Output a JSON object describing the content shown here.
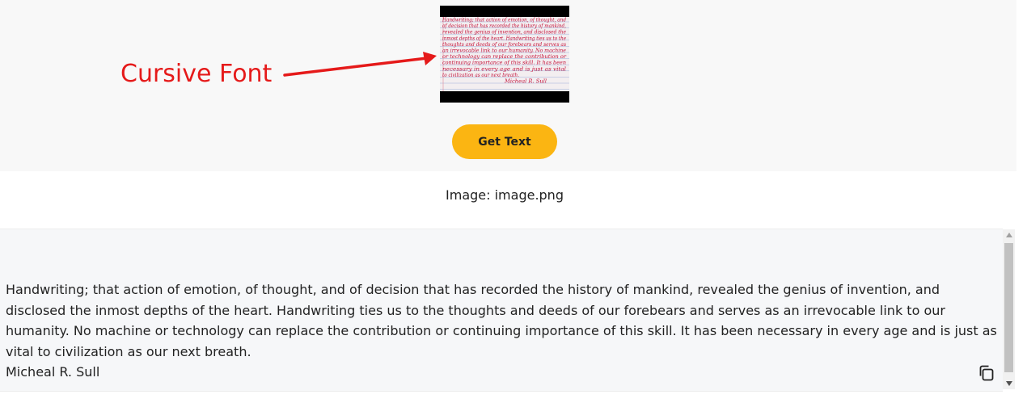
{
  "annotation": {
    "label": "Cursive Font",
    "color": "#e51a1a"
  },
  "preview": {
    "alt": "handwritten cursive sample image",
    "handwriting_lines": [
      "Handwriting; that action of emotion, of thought, and",
      "of decision that has recorded the history of mankind,",
      "revealed the genius of invention, and disclosed the",
      "inmost depths of the heart. Handwriting ties us to the",
      "thoughts and deeds of our forebears and serves as",
      "an irrevocable link to our humanity. No machine",
      "or technology can replace the contribution or",
      "continuing importance of this skill. It has been",
      "necessary in every age and is just as vital",
      "to civilization as our next breath.",
      "Micheal R. Sull"
    ]
  },
  "button": {
    "get_text_label": "Get Text",
    "color": "#fbb512"
  },
  "caption": {
    "image_name": "Image: image.png"
  },
  "result": {
    "paragraph": "Handwriting; that action of emotion, of thought, and of decision that has recorded the history of mankind, revealed the genius of invention, and disclosed the inmost depths of the heart. Handwriting ties us to the thoughts and deeds of our forebears and serves as an irrevocable link to our humanity. No machine or technology can replace the contribution or continuing importance of this skill. It has been necessary in every age and is just as vital to civilization as our next breath.",
    "author": "Micheal R. Sull"
  },
  "icons": {
    "copy": "copy-icon",
    "arrow": "arrow-right-icon",
    "scroll_up": "triangle-up-icon",
    "scroll_down": "triangle-down-icon"
  }
}
